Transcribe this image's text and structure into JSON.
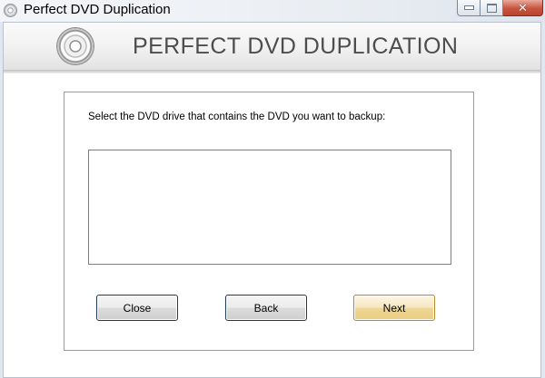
{
  "window": {
    "title": "Perfect DVD Duplication",
    "icon": "disc-icon"
  },
  "banner": {
    "title": "PERFECT DVD DUPLICATION",
    "icon": "disc-icon"
  },
  "main": {
    "instruction": "Select the DVD drive that contains the DVD you want to backup:",
    "drive_list_items": []
  },
  "buttons": {
    "close_label": "Close",
    "back_label": "Back",
    "next_label": "Next"
  },
  "colors": {
    "banner_text": "#4d4d4d",
    "default_button_border": "#b58a2e",
    "button_border": "#1f3b58",
    "close_caption_red": "#c8533e"
  }
}
